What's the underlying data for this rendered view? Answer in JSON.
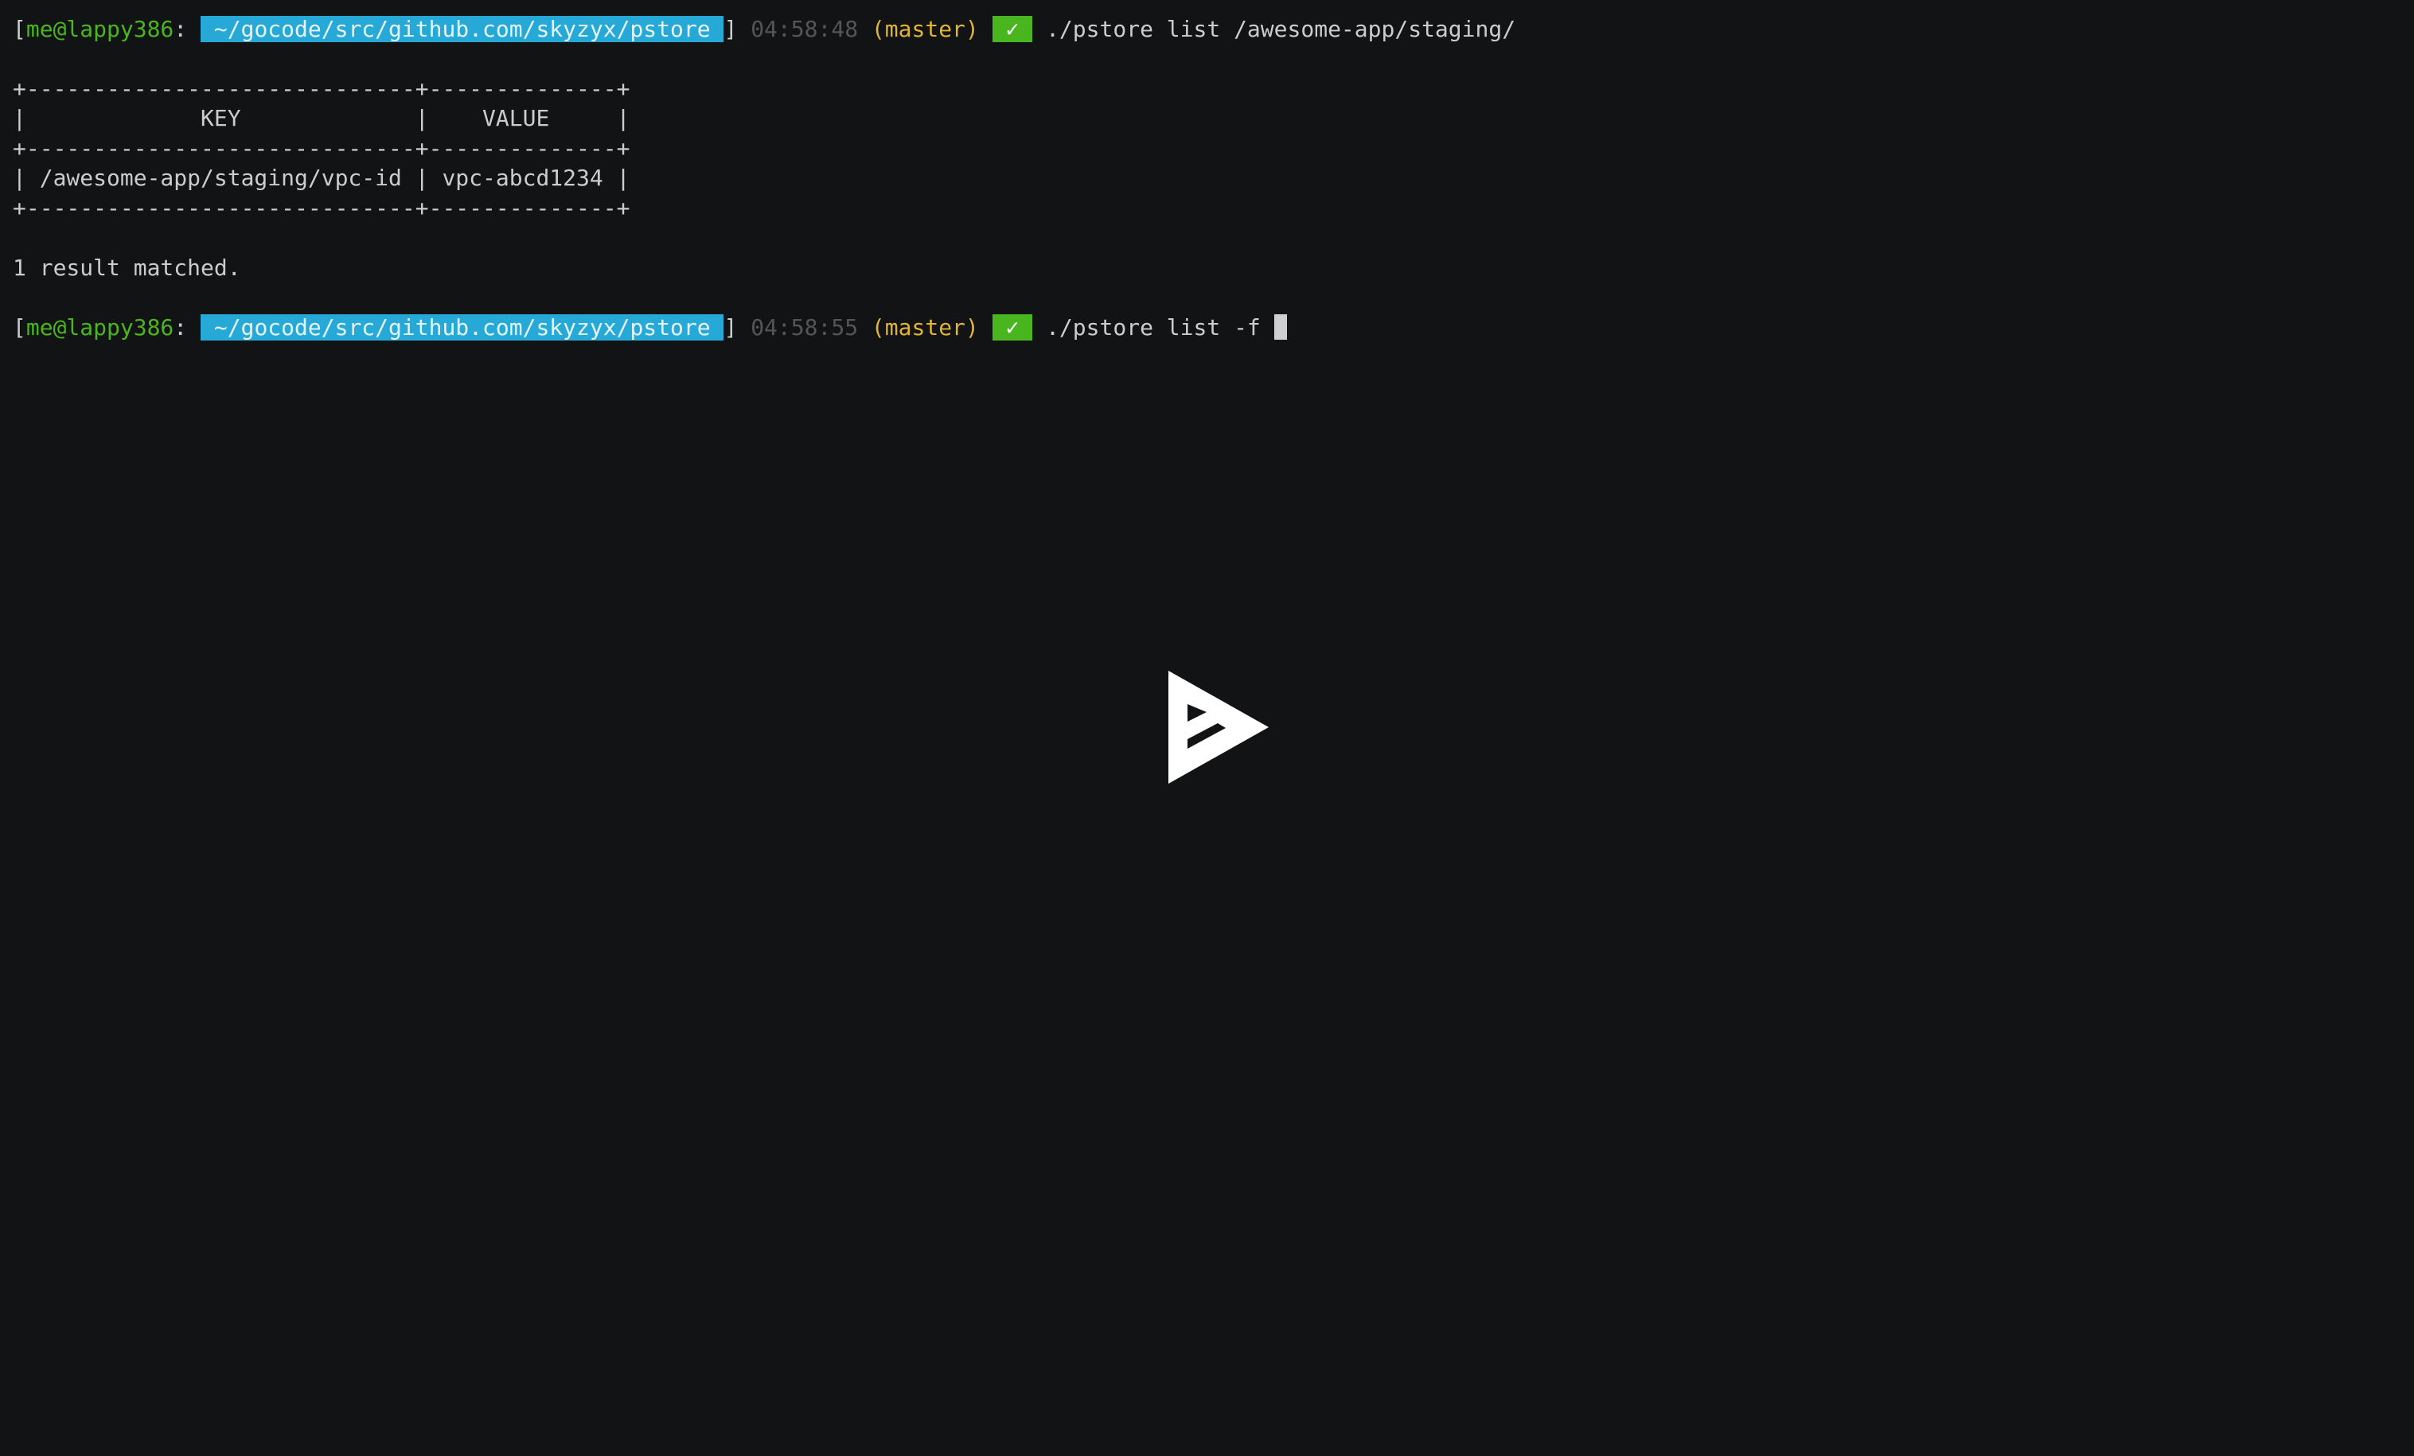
{
  "prompts": [
    {
      "user": "me@lappy386",
      "path": " ~/gocode/src/github.com/skyzyx/pstore ",
      "time": "04:58:48",
      "branch": "(master)",
      "status": " ✓ ",
      "command": "./pstore list /awesome-app/staging/"
    },
    {
      "user": "me@lappy386",
      "path": " ~/gocode/src/github.com/skyzyx/pstore ",
      "time": "04:58:55",
      "branch": "(master)",
      "status": " ✓ ",
      "command": "./pstore list -f "
    }
  ],
  "output": {
    "border_top": "+-----------------------------+--------------+",
    "header_row": "|             KEY             |    VALUE     |",
    "border_mid": "+-----------------------------+--------------+",
    "data_row": "| /awesome-app/staging/vpc-id | vpc-abcd1234 |",
    "border_bottom": "+-----------------------------+--------------+",
    "summary": "1 result matched."
  },
  "colors": {
    "background": "#121314",
    "user": "#4ab61f",
    "path_bg": "#26a9d6",
    "branch": "#e0b437",
    "time": "#555555",
    "status_bg": "#4ab61f"
  },
  "player": {
    "icon": "asciinema-play-icon"
  }
}
